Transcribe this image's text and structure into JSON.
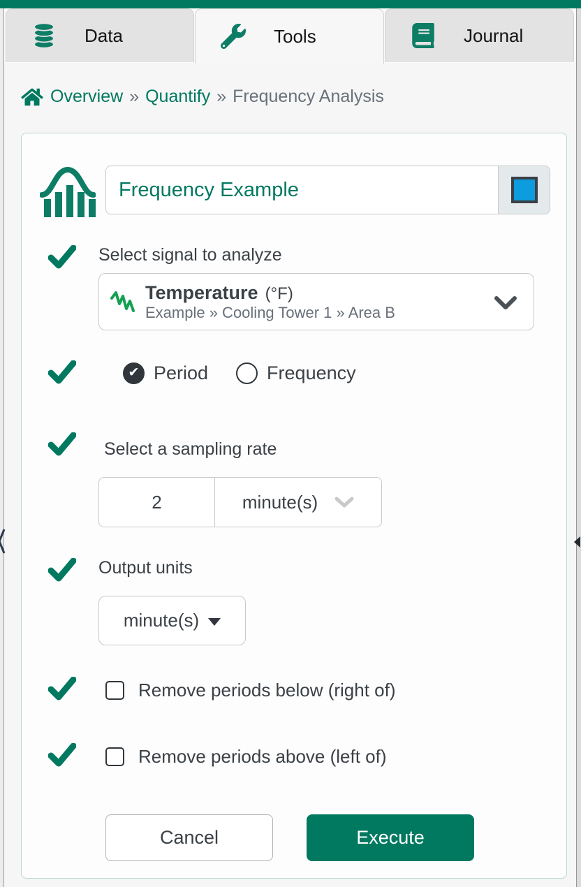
{
  "colors": {
    "brand_green": "#007960",
    "swatch_blue": "#0d9dde",
    "signal_green": "#13a152"
  },
  "tabs": [
    {
      "label": "Data",
      "icon": "database-icon",
      "active": false
    },
    {
      "label": "Tools",
      "icon": "wrench-icon",
      "active": true
    },
    {
      "label": "Journal",
      "icon": "book-icon",
      "active": false
    }
  ],
  "breadcrumb": {
    "separator": "»",
    "links": [
      "Overview",
      "Quantify"
    ],
    "current": "Frequency Analysis"
  },
  "tool": {
    "name_value": "Frequency Example",
    "signal": {
      "label": "Select signal to analyze",
      "name": "Temperature",
      "unit": "(°F)",
      "path": "Example » Cooling Tower 1 » Area B"
    },
    "mode": {
      "options": [
        {
          "label": "Period",
          "selected": true
        },
        {
          "label": "Frequency",
          "selected": false
        }
      ]
    },
    "sampling": {
      "label": "Select a sampling rate",
      "value": "2",
      "unit": "minute(s)"
    },
    "output": {
      "label": "Output units",
      "value": "minute(s)"
    },
    "options": [
      {
        "label": "Remove periods below (right of)",
        "checked": false
      },
      {
        "label": "Remove periods above (left of)",
        "checked": false
      }
    ],
    "actions": {
      "cancel": "Cancel",
      "execute": "Execute"
    }
  }
}
